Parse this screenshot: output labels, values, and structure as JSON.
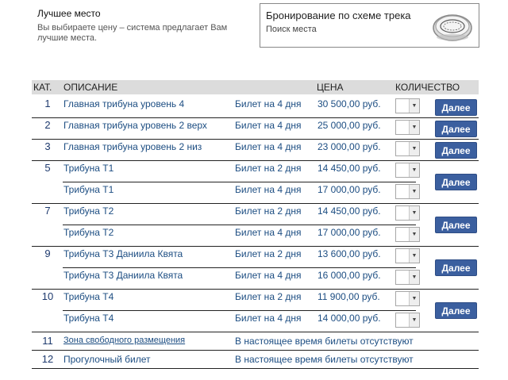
{
  "best": {
    "title": "Лучшее место",
    "desc1": "Вы выбираете цену – система предлагает Вам",
    "desc2": "лучшие места."
  },
  "scheme": {
    "title": "Бронирование по схеме трека",
    "link": "Поиск места",
    "icon": "race-track-icon"
  },
  "table": {
    "headers": {
      "cat": "КАТ.",
      "desc": "ОПИСАНИЕ",
      "price": "ЦЕНА",
      "qty": "КОЛИЧЕСТВО"
    },
    "button_label": "Далее",
    "groups": [
      {
        "cat": "1",
        "rows": [
          {
            "desc": "Главная трибуна уровень 4",
            "ticket": "Билет на 4 дня",
            "price": "30 500,00 руб."
          }
        ]
      },
      {
        "cat": "2",
        "rows": [
          {
            "desc": "Главная трибуна уровень 2 верх",
            "ticket": "Билет на 4 дня",
            "price": "25 000,00 руб."
          }
        ]
      },
      {
        "cat": "3",
        "rows": [
          {
            "desc": "Главная трибуна уровень 2 низ",
            "ticket": "Билет на 4 дня",
            "price": "23 000,00 руб."
          }
        ]
      },
      {
        "cat": "5",
        "rows": [
          {
            "desc": "Трибуна Т1",
            "ticket": "Билет на 2 дня",
            "price": "14 450,00 руб."
          },
          {
            "desc": "Трибуна Т1",
            "ticket": "Билет на 4 дня",
            "price": "17 000,00 руб."
          }
        ]
      },
      {
        "cat": "7",
        "rows": [
          {
            "desc": "Трибуна Т2",
            "ticket": "Билет на 2 дня",
            "price": "14 450,00 руб."
          },
          {
            "desc": "Трибуна Т2",
            "ticket": "Билет на 4 дня",
            "price": "17 000,00 руб."
          }
        ]
      },
      {
        "cat": "9",
        "rows": [
          {
            "desc": "Трибуна Т3 Даниила Квята",
            "ticket": "Билет на 2 дня",
            "price": "13 600,00 руб."
          },
          {
            "desc": "Трибуна Т3 Даниила Квята",
            "ticket": "Билет на 4 дня",
            "price": "16 000,00 руб."
          }
        ]
      },
      {
        "cat": "10",
        "rows": [
          {
            "desc": "Трибуна Т4",
            "ticket": "Билет на 2 дня",
            "price": "11 900,00 руб."
          },
          {
            "desc": "Трибуна Т4",
            "ticket": "Билет на 4 дня",
            "price": "14 000,00 руб."
          }
        ]
      }
    ],
    "unavailable": [
      {
        "cat": "11",
        "desc": "Зона свободного размещения",
        "status": "В настоящее время билеты отсутствуют"
      },
      {
        "cat": "12",
        "desc": "Прогулочный билет",
        "status": "В настоящее время билеты отсутствуют"
      }
    ]
  }
}
